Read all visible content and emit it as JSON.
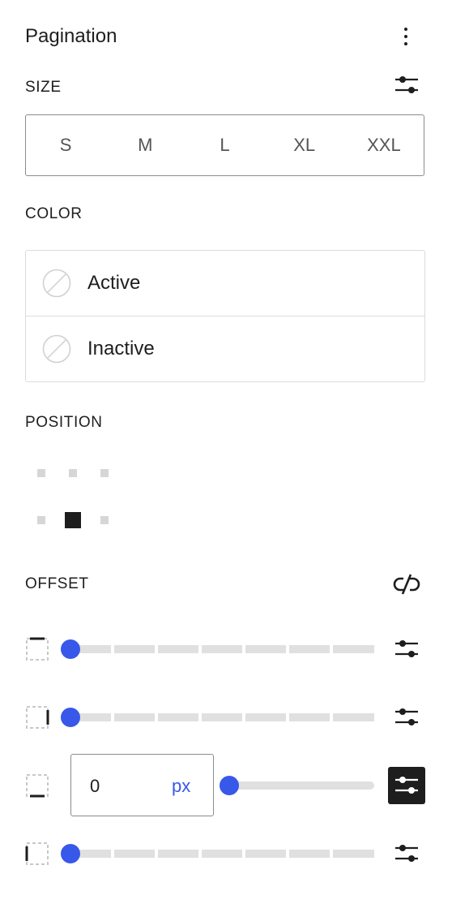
{
  "panel": {
    "title": "Pagination"
  },
  "size": {
    "label": "SIZE",
    "options": [
      "S",
      "M",
      "L",
      "XL",
      "XXL"
    ]
  },
  "color": {
    "label": "COLOR",
    "items": [
      {
        "label": "Active"
      },
      {
        "label": "Inactive"
      }
    ]
  },
  "position": {
    "label": "POSITION",
    "selected": "middle-center"
  },
  "offset": {
    "label": "OFFSET",
    "rows": [
      {
        "side": "top",
        "value": 0
      },
      {
        "side": "right",
        "value": 0
      },
      {
        "side": "bottom",
        "value": "0",
        "unit": "px"
      },
      {
        "side": "left",
        "value": 0
      }
    ]
  },
  "colors": {
    "accent": "#3858e9",
    "text": "#1e1e1e",
    "border": "#8c8c8c",
    "track": "#e0e0e0"
  },
  "icons": {
    "menu": "vertical-ellipsis-icon",
    "settings": "sliders-icon",
    "link": "unlink-icon",
    "swatch": "no-color-swatch-icon"
  }
}
